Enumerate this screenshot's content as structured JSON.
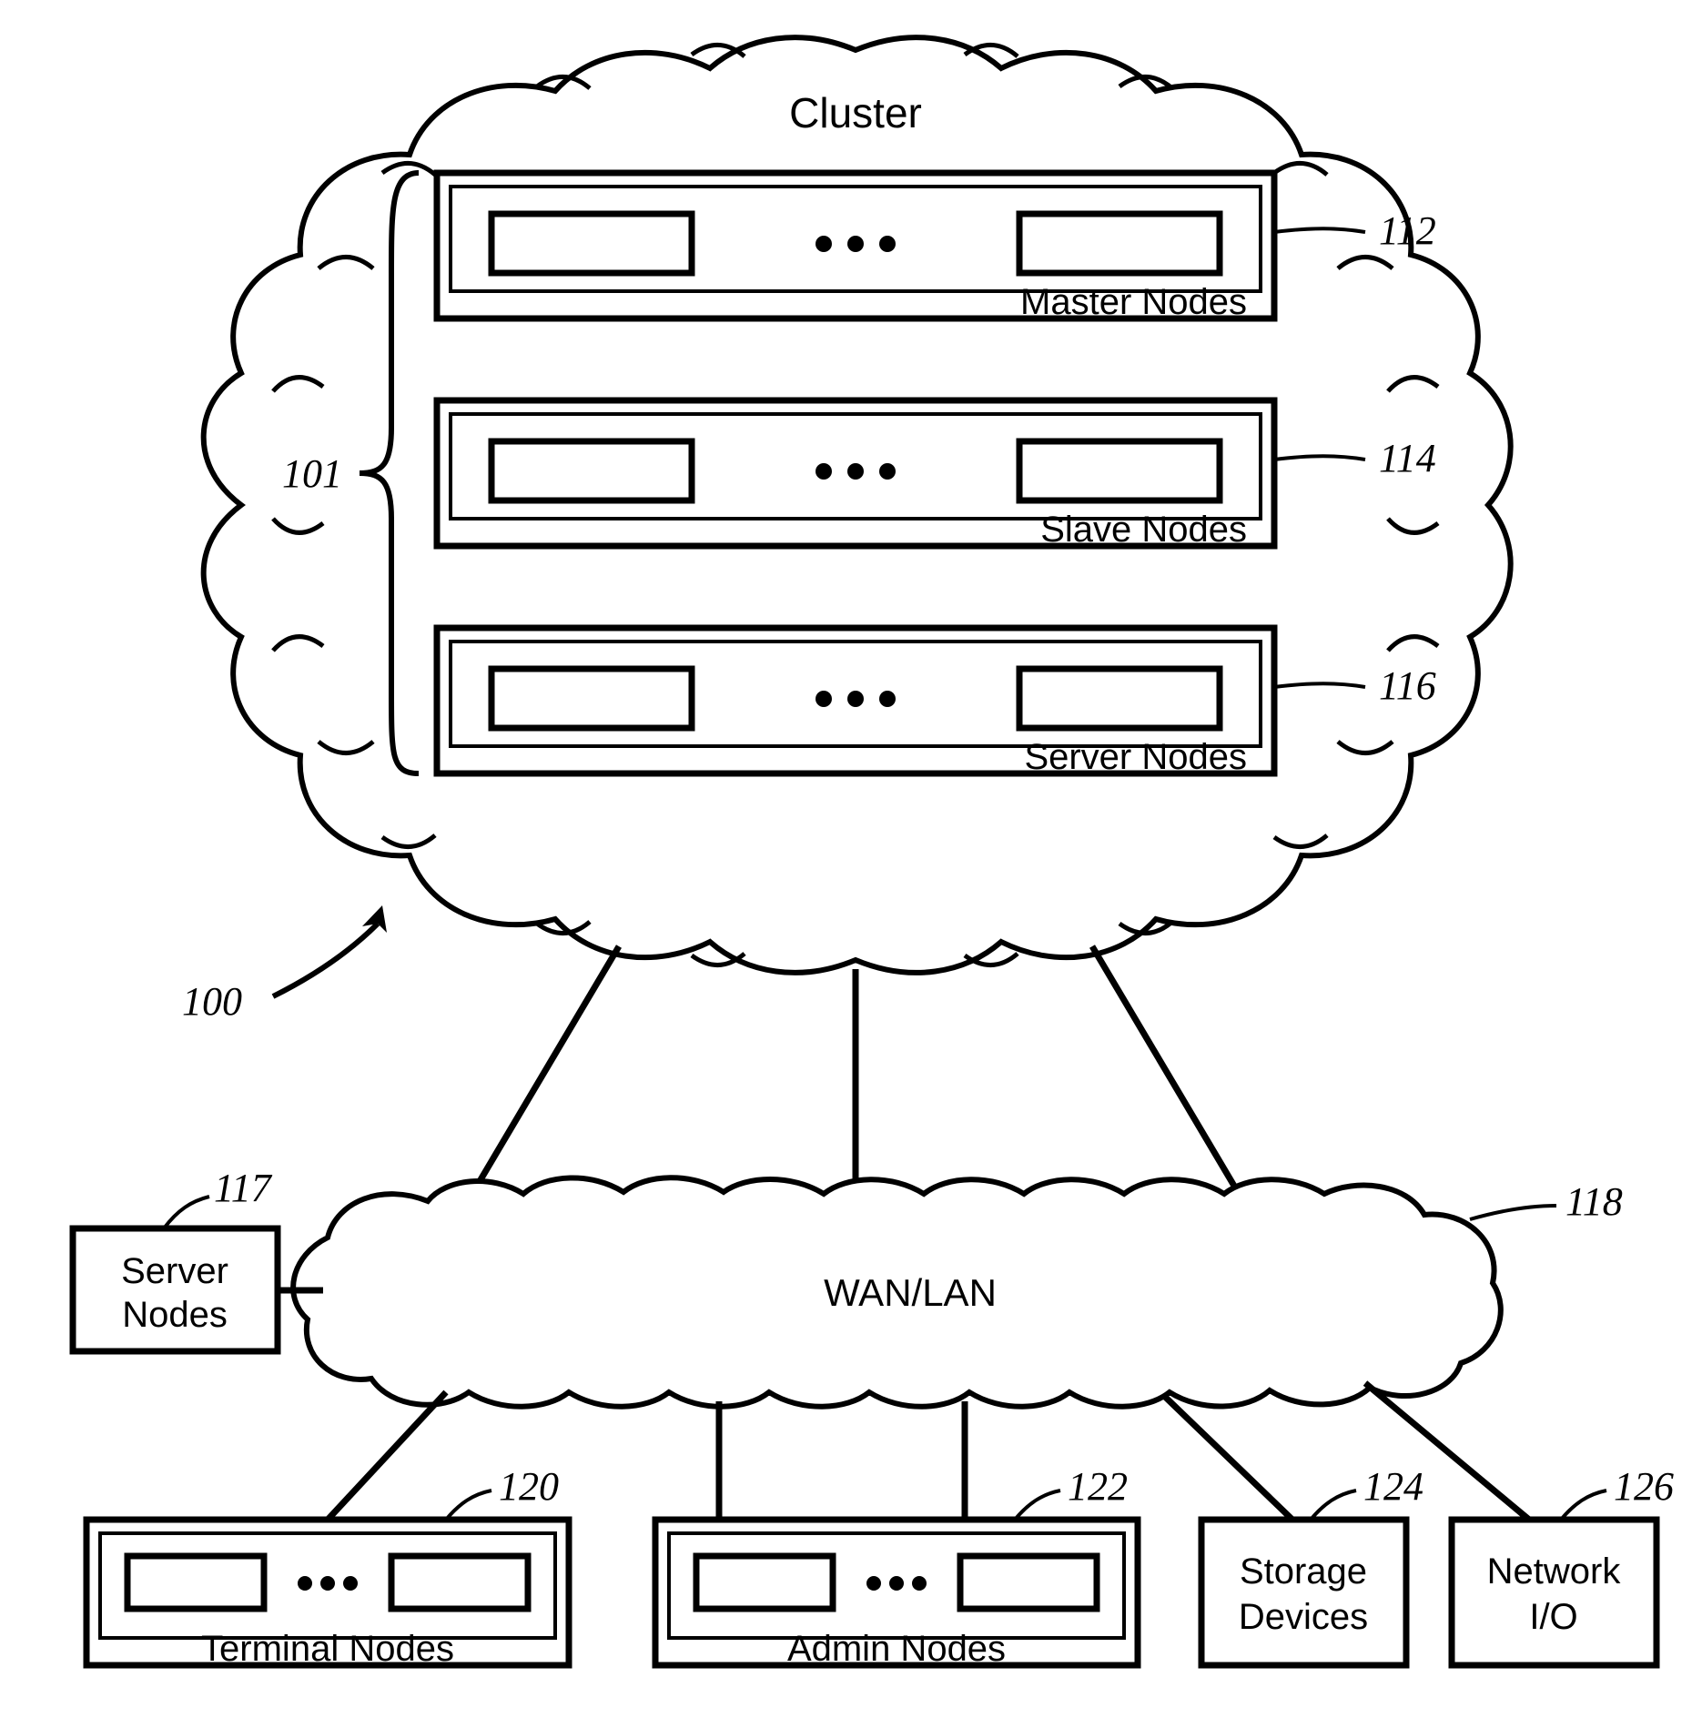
{
  "title": "Cluster",
  "ref_100": "100",
  "ref_101": "101",
  "nodes_in_cluster": [
    {
      "label": "Master Nodes",
      "ref": "112"
    },
    {
      "label": "Slave Nodes",
      "ref": "114"
    },
    {
      "label": "Server Nodes",
      "ref": "116"
    }
  ],
  "wan": {
    "label": "WAN/LAN",
    "ref": "118"
  },
  "server_nodes_box": {
    "label_line1": "Server",
    "label_line2": "Nodes",
    "ref": "117"
  },
  "bottom": [
    {
      "label": "Terminal Nodes",
      "ref": "120"
    },
    {
      "label": "Admin Nodes",
      "ref": "122"
    },
    {
      "label_line1": "Storage",
      "label_line2": "Devices",
      "ref": "124"
    },
    {
      "label_line1": "Network",
      "label_line2": "I/O",
      "ref": "126"
    }
  ]
}
